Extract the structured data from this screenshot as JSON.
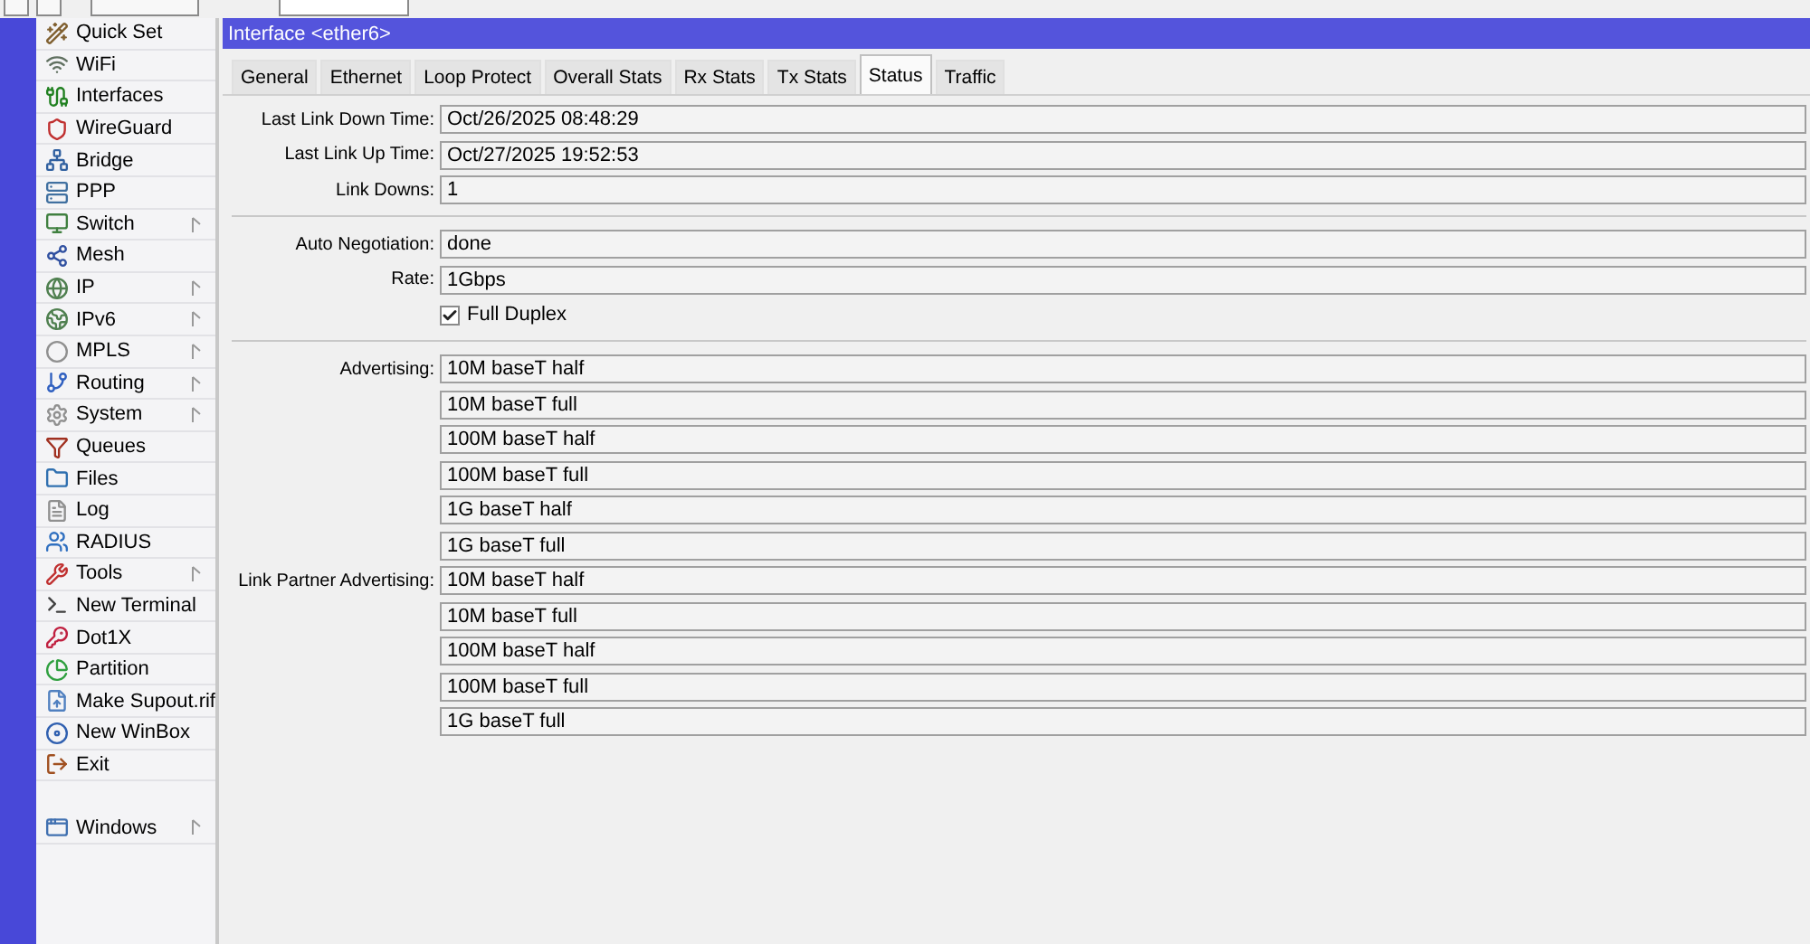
{
  "sidebar": {
    "items": [
      {
        "label": "Quick Set",
        "submenu": false
      },
      {
        "label": "WiFi",
        "submenu": false
      },
      {
        "label": "Interfaces",
        "submenu": false
      },
      {
        "label": "WireGuard",
        "submenu": false
      },
      {
        "label": "Bridge",
        "submenu": false
      },
      {
        "label": "PPP",
        "submenu": false
      },
      {
        "label": "Switch",
        "submenu": true
      },
      {
        "label": "Mesh",
        "submenu": false
      },
      {
        "label": "IP",
        "submenu": true
      },
      {
        "label": "IPv6",
        "submenu": true
      },
      {
        "label": "MPLS",
        "submenu": true
      },
      {
        "label": "Routing",
        "submenu": true
      },
      {
        "label": "System",
        "submenu": true
      },
      {
        "label": "Queues",
        "submenu": false
      },
      {
        "label": "Files",
        "submenu": false
      },
      {
        "label": "Log",
        "submenu": false
      },
      {
        "label": "RADIUS",
        "submenu": false
      },
      {
        "label": "Tools",
        "submenu": true
      },
      {
        "label": "New Terminal",
        "submenu": false
      },
      {
        "label": "Dot1X",
        "submenu": false
      },
      {
        "label": "Partition",
        "submenu": false
      },
      {
        "label": "Make Supout.rif",
        "submenu": false
      },
      {
        "label": "New WinBox",
        "submenu": false
      },
      {
        "label": "Exit",
        "submenu": false
      }
    ],
    "bottom_items": [
      {
        "label": "Windows",
        "submenu": true
      }
    ]
  },
  "window": {
    "title": "Interface <ether6>",
    "tabs": [
      {
        "label": "General",
        "selected": false
      },
      {
        "label": "Ethernet",
        "selected": false
      },
      {
        "label": "Loop Protect",
        "selected": false
      },
      {
        "label": "Overall Stats",
        "selected": false
      },
      {
        "label": "Rx Stats",
        "selected": false
      },
      {
        "label": "Tx Stats",
        "selected": false
      },
      {
        "label": "Status",
        "selected": true
      },
      {
        "label": "Traffic",
        "selected": false
      }
    ],
    "sections": [
      {
        "rows": [
          {
            "kind": "field",
            "label": "Last Link Down Time:",
            "value": "Oct/26/2025 08:48:29"
          },
          {
            "kind": "field",
            "label": "Last Link Up Time:",
            "value": "Oct/27/2025 19:52:53"
          },
          {
            "kind": "field",
            "label": "Link Downs:",
            "value": "1"
          }
        ]
      },
      {
        "rows": [
          {
            "kind": "field",
            "label": "Auto Negotiation:",
            "value": "done"
          },
          {
            "kind": "field",
            "label": "Rate:",
            "value": "1Gbps"
          },
          {
            "kind": "checkbox",
            "label": "Full Duplex",
            "checked": true
          }
        ]
      },
      {
        "rows": [
          {
            "kind": "field",
            "label": "Advertising:",
            "value": "10M baseT half"
          },
          {
            "kind": "field",
            "value": "10M baseT full"
          },
          {
            "kind": "field",
            "value": "100M baseT half"
          },
          {
            "kind": "field",
            "value": "100M baseT full"
          },
          {
            "kind": "field",
            "value": "1G baseT half"
          },
          {
            "kind": "field",
            "value": "1G baseT full"
          },
          {
            "kind": "field",
            "label": "Link Partner Advertising:",
            "value": "10M baseT half"
          },
          {
            "kind": "field",
            "value": "10M baseT full"
          },
          {
            "kind": "field",
            "value": "100M baseT half"
          },
          {
            "kind": "field",
            "value": "100M baseT full"
          },
          {
            "kind": "field",
            "value": "1G baseT full"
          }
        ]
      }
    ]
  }
}
